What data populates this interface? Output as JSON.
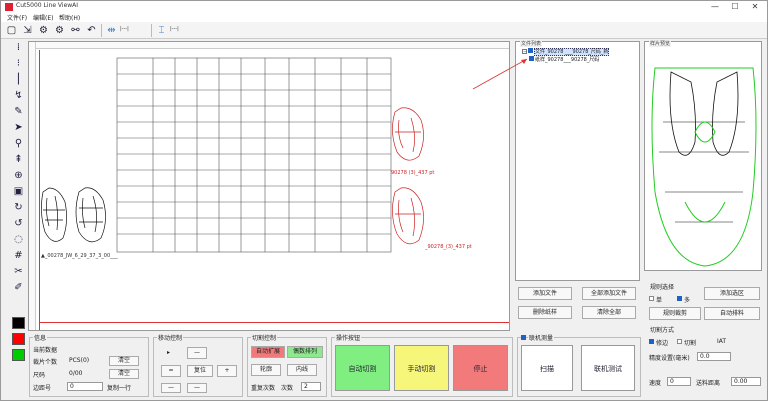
{
  "app": {
    "title": "Cut5000 Line ViewAI",
    "window_controls": [
      "—",
      "☐",
      "✕"
    ]
  },
  "menu": [
    "文件(F)",
    "编辑(E)",
    "帮助(H)"
  ],
  "canvas": {
    "thumbnail_caption": "▲_00278_JW_6_29_37_3_00___",
    "red_label_1": "90278 (3)_437 pt",
    "red_label_2": "_90278_(3)_437 pt"
  },
  "file_panel": {
    "label": "文件列表",
    "items": [
      {
        "name": "文件_90278 ___90278_尺码_新",
        "selected": true
      },
      {
        "name": "纸样_90278___90278_尺码",
        "selected": false
      }
    ]
  },
  "preview_panel": {
    "label": "样片预览"
  },
  "file_buttons": [
    "添加文件",
    "全部添加文件",
    "删除纸样",
    "清除全部"
  ],
  "cut_options": {
    "label": "规则选择",
    "single_label": "单",
    "multi_label": "多",
    "btn_primary": "添加选区",
    "btn_rule": "规则裁剪",
    "btn_auto": "自动排料"
  },
  "cut_mode": {
    "label": "切割方式",
    "mode_a": "修边",
    "mode_b": "切割",
    "mode_c": "IAT",
    "precision_label": "精度设置(毫米)",
    "precision_value": "0.0",
    "speed_label": "速度",
    "speed_value": "0",
    "feed_label": "送料距离",
    "feed_value": "0.00"
  },
  "left_info": {
    "header": "信息",
    "rows": [
      {
        "label": "当前数据",
        "value": ""
      },
      {
        "label": "裁片个数",
        "value": "PCS(0)",
        "btn": "清空"
      },
      {
        "label": "尺码",
        "value": "0/00",
        "btn": "清空"
      },
      {
        "label": "边距号",
        "value": "0",
        "btn": "复制一行"
      }
    ]
  },
  "nudge": {
    "label": "移动控制",
    "center": "复位"
  },
  "cut_control": {
    "label": "切割控制",
    "btn_red": "自动扩展",
    "btn_green": "偶数排列",
    "btn_a": "轮廓",
    "btn_b": "内线",
    "repeat_label": "重复次数",
    "repeat_value": "2",
    "count_label": "次数"
  },
  "run_panel": {
    "label": "操作按钮",
    "start": "自动切割",
    "pause": "手动切割",
    "stop": "停止",
    "label2": "联机测量",
    "btn_a": "扫描",
    "btn_b": "联机测试"
  },
  "colors": {
    "swatch_black": "#000000",
    "swatch_red": "#ff0000",
    "swatch_green": "#00cc00",
    "start_green": "#80ee80",
    "pause_yellow": "#f6f67a",
    "stop_red": "#f27a7a",
    "red_btn": "#f07a7a",
    "green_btn": "#8ee88e"
  }
}
